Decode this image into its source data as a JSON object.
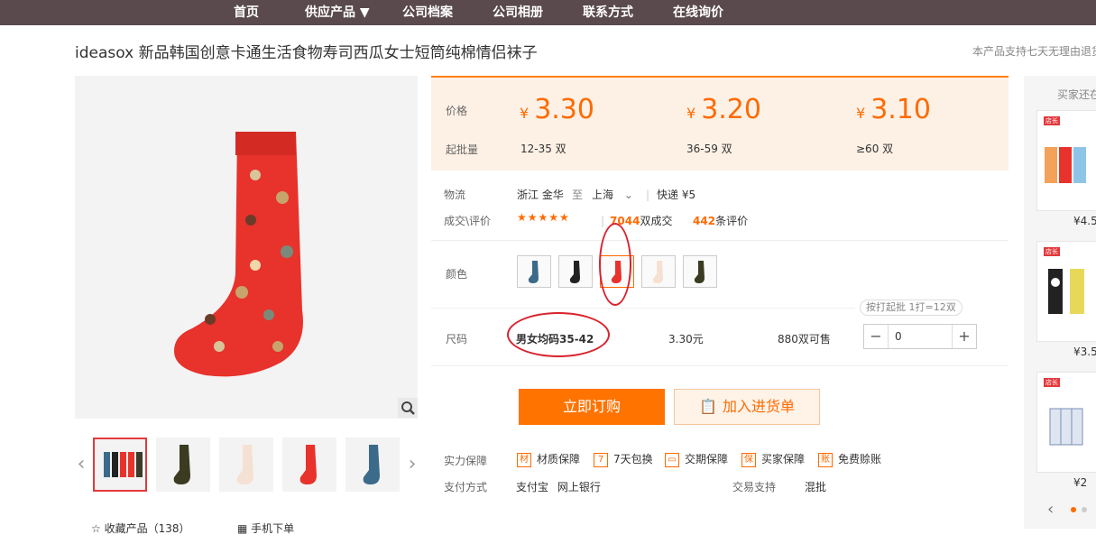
{
  "nav": {
    "items": [
      "首页",
      "供应产品 ▼",
      "公司档案",
      "公司相册",
      "联系方式",
      "在线询价"
    ]
  },
  "product": {
    "title": "ideasox 新品韩国创意卡通生活食物寿司西瓜女士短筒纯棉情侣袜子",
    "notice": "本产品支持七天无理由退货"
  },
  "gallery": {
    "prev": "‹",
    "next": "›"
  },
  "pricing": {
    "price_label": "价格",
    "qty_label": "起批量",
    "currency": "¥",
    "tiers": [
      {
        "price": "3.30",
        "range": "12-35 双"
      },
      {
        "price": "3.20",
        "range": "36-59 双"
      },
      {
        "price": "3.10",
        "range": "≥60 双"
      }
    ]
  },
  "logistics": {
    "label": "物流",
    "from": "浙江 金华",
    "to_word": "至",
    "to": "上海",
    "method": "快递 ¥5"
  },
  "deals": {
    "label": "成交\\评价",
    "stars": "★★★★★",
    "sold_count": "7044",
    "sold_suffix": "双成交",
    "review_count": "442",
    "review_suffix": "条评价"
  },
  "color": {
    "label": "颜色"
  },
  "size": {
    "label": "尺码",
    "tip": "按打起批 1打=12双",
    "name": "男女均码35-42",
    "unit_price": "3.30元",
    "stock": "880双可售",
    "qty": "0"
  },
  "actions": {
    "order": "立即订购",
    "cart": "加入进货单"
  },
  "guarantees": {
    "label": "实力保障",
    "items": [
      {
        "icon": "材",
        "text": "材质保障"
      },
      {
        "icon": "7",
        "text": "7天包换"
      },
      {
        "icon": "▭",
        "text": "交期保障"
      },
      {
        "icon": "保",
        "text": "买家保障"
      },
      {
        "icon": "账",
        "text": "免费赊账"
      }
    ]
  },
  "payment": {
    "label": "支付方式",
    "methods": "支付宝 网上银行",
    "trade_label": "交易支持",
    "trade_value": "混批"
  },
  "footer": {
    "favorite": "收藏产品（138）",
    "mobile": "手机下单"
  },
  "rail": {
    "heading": "买家还在看",
    "tag": "店长",
    "prices": [
      "¥4.5",
      "¥3.5",
      "¥2"
    ]
  },
  "colors": {
    "accent": "#ff6a00",
    "nav_bg": "#5a4a4d",
    "price_bg": "#fdf1e6",
    "highlight_ring": "#d9232e"
  }
}
